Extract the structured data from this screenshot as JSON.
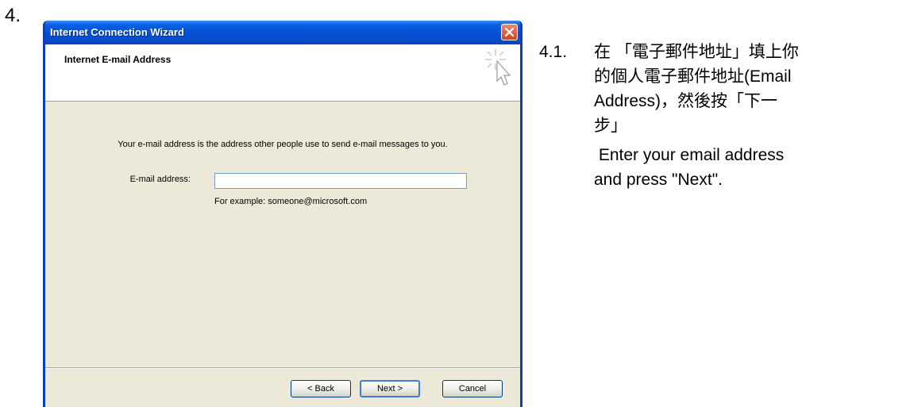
{
  "step_number": "4.",
  "window": {
    "title": "Internet Connection Wizard",
    "header_title": "Internet E-mail Address",
    "description": "Your e-mail address is the address other people use to send e-mail messages to you.",
    "email_label": "E-mail address:",
    "email_value": "",
    "example_text": "For example: someone@microsoft.com",
    "buttons": {
      "back": "< Back",
      "next": "Next >",
      "cancel": "Cancel"
    }
  },
  "instructions": {
    "number": "4.1.",
    "zh_line1": "在 「電子郵件地址」填上你",
    "zh_line2": "的個人電子郵件地址(Email",
    "zh_line3": "Address)，然後按「下一",
    "zh_line4": "步」",
    "en_line1": " Enter your email address",
    "en_line2": "and press \"Next\"."
  },
  "colors": {
    "titlebar": "#0350d6",
    "dialog_bg": "#ece9d8",
    "close_button": "#d4431a"
  }
}
